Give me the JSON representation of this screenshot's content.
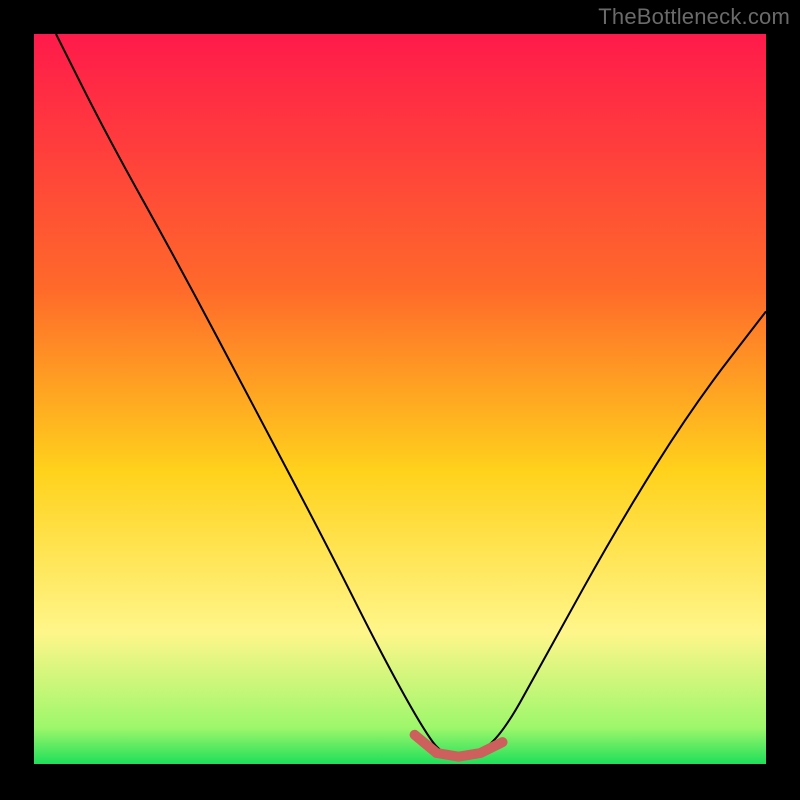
{
  "watermark": "TheBottleneck.com",
  "chart_data": {
    "type": "line",
    "title": "",
    "xlabel": "",
    "ylabel": "",
    "xlim": [
      0,
      100
    ],
    "ylim": [
      0,
      100
    ],
    "grid": false,
    "legend": false,
    "series": [
      {
        "name": "bottleneck-curve",
        "x": [
          3,
          10,
          20,
          30,
          40,
          47,
          53,
          56,
          60,
          64,
          70,
          80,
          90,
          100
        ],
        "values": [
          100,
          86,
          68,
          49,
          30,
          16,
          5,
          1,
          1,
          4,
          15,
          33,
          49,
          62
        ]
      },
      {
        "name": "optimal-band",
        "x": [
          52,
          55,
          58,
          61,
          64
        ],
        "values": [
          4,
          1.5,
          1,
          1.5,
          3
        ]
      }
    ],
    "colors": {
      "curve": "#000000",
      "band": "#cd5f5c",
      "gradient_stops": [
        {
          "pos": 0.0,
          "color": "#ff1a4b"
        },
        {
          "pos": 0.35,
          "color": "#ff6a2a"
        },
        {
          "pos": 0.6,
          "color": "#ffd21c"
        },
        {
          "pos": 0.82,
          "color": "#fff68a"
        },
        {
          "pos": 0.95,
          "color": "#9ef76b"
        },
        {
          "pos": 1.0,
          "color": "#1fdf5a"
        }
      ]
    }
  }
}
